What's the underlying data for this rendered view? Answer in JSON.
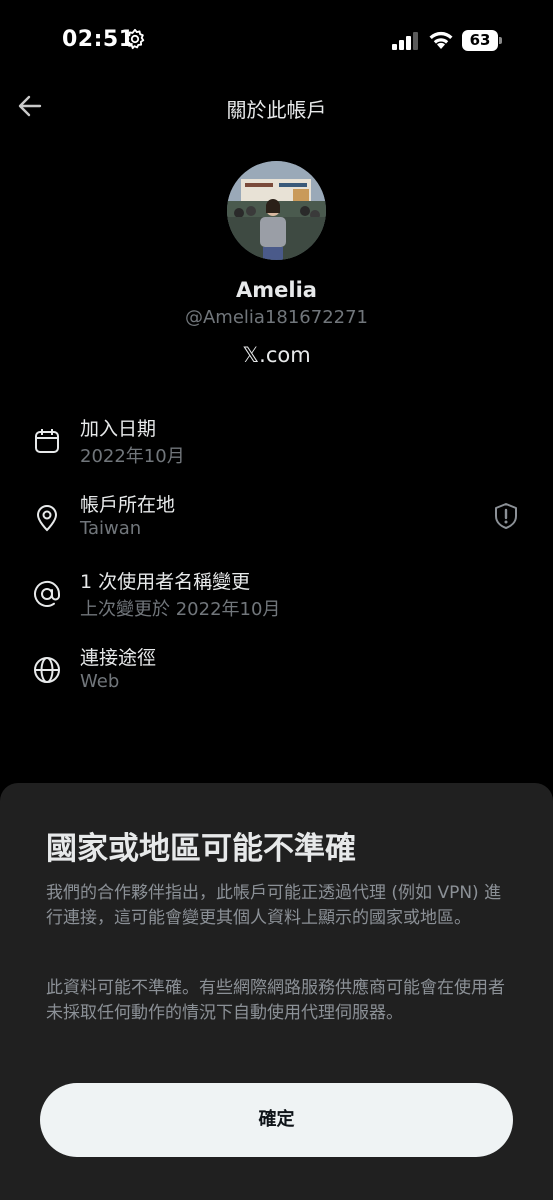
{
  "status_bar": {
    "time": "02:51",
    "battery": "63"
  },
  "header": {
    "title": "關於此帳戶"
  },
  "profile": {
    "name": "Amelia",
    "handle": "@Amelia181672271",
    "site": "𝕏.com"
  },
  "rows": [
    {
      "icon": "calendar-icon",
      "title": "加入日期",
      "subtitle": "2022年10月"
    },
    {
      "icon": "location-pin-icon",
      "title": "帳戶所在地",
      "subtitle": "Taiwan"
    },
    {
      "icon": "at-sign-icon",
      "title": "1 次使用者名稱變更",
      "subtitle": "上次變更於 2022年10月"
    },
    {
      "icon": "globe-icon",
      "title": "連接途徑",
      "subtitle": "Web"
    }
  ],
  "sheet": {
    "title": "國家或地區可能不準確",
    "paragraph1": "我們的合作夥伴指出，此帳戶可能正透過代理 (例如 VPN) 進行連接，這可能會變更其個人資料上顯示的國家或地區。",
    "paragraph2": "此資料可能不準確。有些網際網路服務供應商可能會在使用者未採取任何動作的情況下自動使用代理伺服器。",
    "button_label": "確定"
  },
  "colors": {
    "background": "#000000",
    "sheet": "#202020",
    "muted": "#71767b",
    "button": "#eff3f4"
  }
}
